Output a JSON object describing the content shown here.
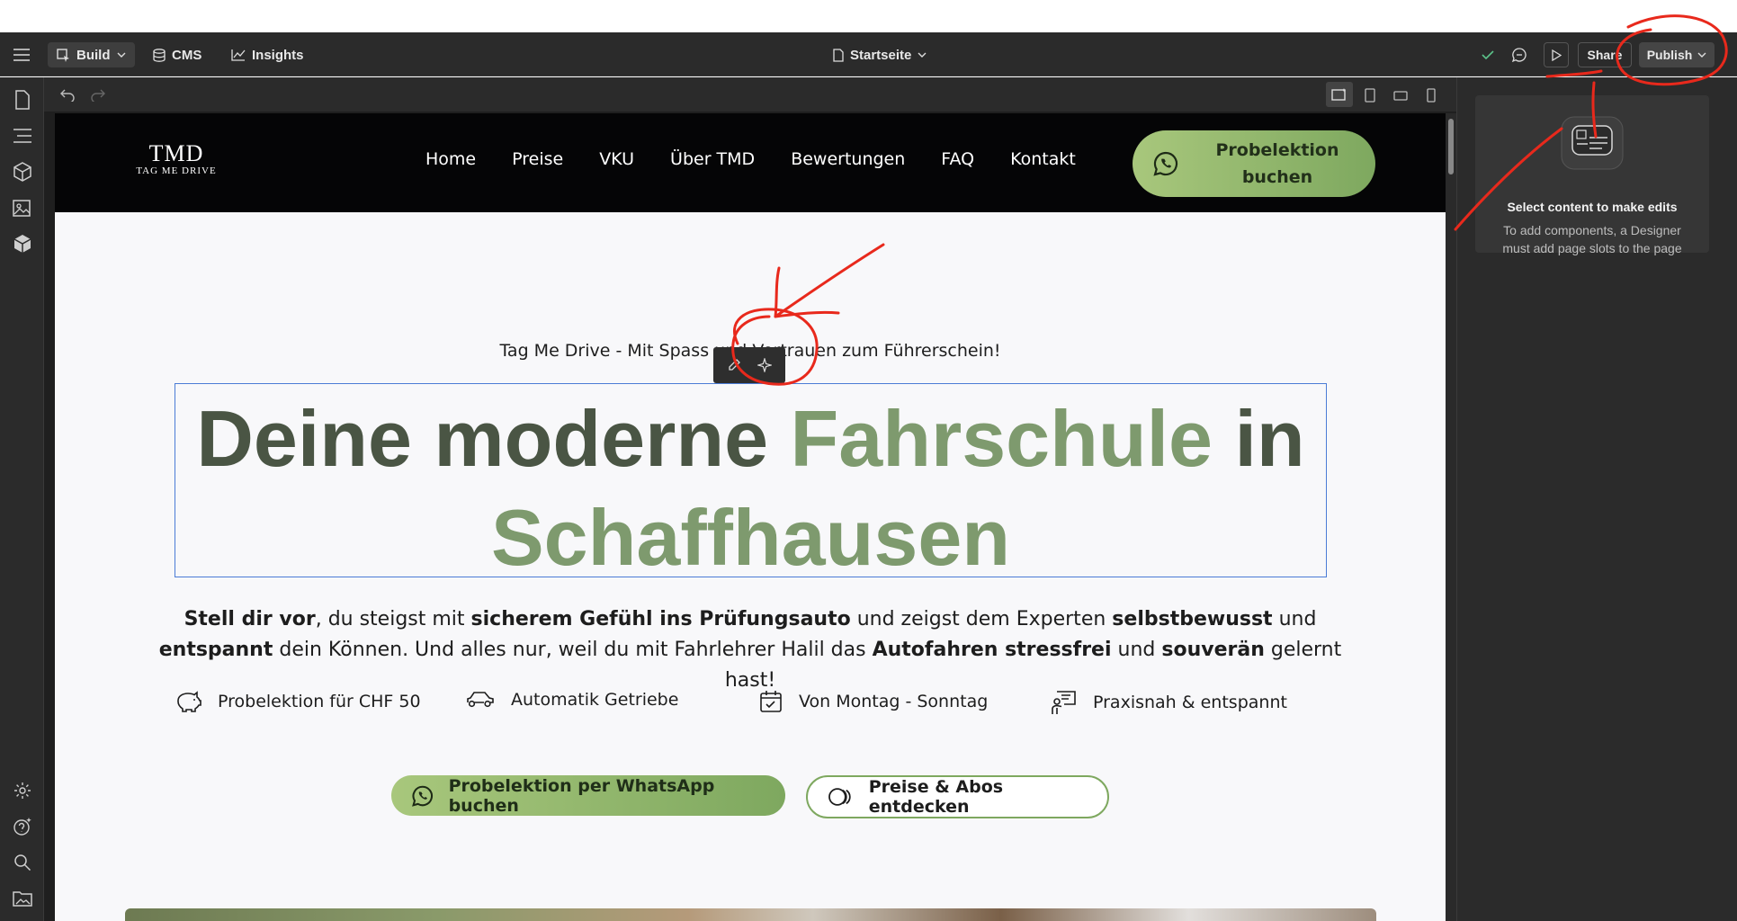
{
  "topbar": {
    "build_label": "Build",
    "cms_label": "CMS",
    "insights_label": "Insights",
    "page_name": "Startseite",
    "share_label": "Share",
    "publish_label": "Publish"
  },
  "right_panel": {
    "title": "Select content to make edits",
    "subtitle": "To add components, a Designer must add page slots to the page"
  },
  "site": {
    "logo_main": "TMD",
    "logo_sub": "TAG ME DRIVE",
    "nav": [
      "Home",
      "Preise",
      "VKU",
      "Über TMD",
      "Bewertungen",
      "FAQ",
      "Kontakt"
    ],
    "header_cta_line1": "Probelektion",
    "header_cta_line2": "buchen"
  },
  "hero": {
    "kicker": "Tag Me Drive - Mit Spass und Vertrauen zum Führerschein!",
    "title_part1": "Deine moderne ",
    "title_accent1": "Fahrschule",
    "title_part2": " in",
    "title_accent2": "Schaffhausen",
    "text": {
      "t1": "Stell dir vor",
      "t2": ", du steigst mit ",
      "t3": "sicherem Gefühl ins Prüfungsauto",
      "t4": " und zeigst dem Experten ",
      "t5": "selbstbewusst",
      "t6": " und ",
      "t7": "entspannt",
      "t8": " dein Können. Und alles nur, weil du mit Fahrlehrer Halil das ",
      "t9": "Autofahren stressfrei",
      "t10": " und ",
      "t11": "souverän",
      "t12": " gelernt hast!"
    },
    "features": [
      "Probelektion für CHF 50",
      "Automatik Getriebe",
      "Von Montag - Sonntag",
      "Praxisnah & entspannt"
    ],
    "primary_button": "Probelektion per WhatsApp buchen",
    "secondary_button": "Preise & Abos entdecken"
  },
  "colors": {
    "accent_green": "#7ea85f",
    "annotation_red": "#e8291c",
    "selection_blue": "#4b7cd6"
  }
}
